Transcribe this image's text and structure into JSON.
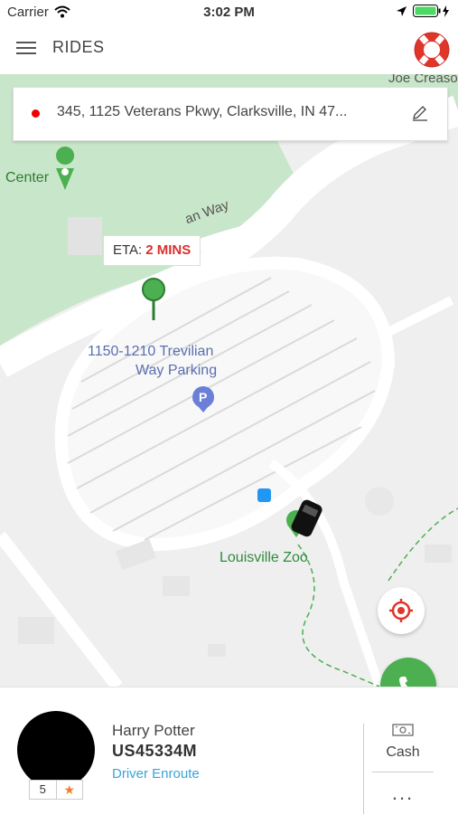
{
  "status_bar": {
    "carrier": "Carrier",
    "time": "3:02 PM"
  },
  "header": {
    "title": "RIDES",
    "menu_icon": "hamburger-icon",
    "help_icon": "lifebuoy-icon"
  },
  "map": {
    "pickup_address": "345, 1125 Veterans Pkwy, Clarksville, IN 47...",
    "eta_label": "ETA:",
    "eta_value": "2 MINS",
    "labels": {
      "center": "Center",
      "road": "an Way",
      "parking_line1": "1150-1210 Trevilian",
      "parking_line2": "Way Parking",
      "zoo": "Louisville Zoo",
      "joe": "Joe Creaso"
    },
    "colors": {
      "park": "#c8e6c9",
      "pin": "#4caf50",
      "poi_label": "#5b6fb0",
      "zoo_label": "#2e8b3e"
    }
  },
  "driver": {
    "name": "Harry Potter",
    "vehicle_id": "US45334M",
    "status": "Driver Enroute",
    "rating": "5"
  },
  "payment": {
    "method": "Cash",
    "more": "..."
  },
  "colors": {
    "eta_accent": "#d9302c",
    "status_accent": "#3aa3d8",
    "call_button": "#4caf50",
    "rating_star": "#f57c2b"
  }
}
